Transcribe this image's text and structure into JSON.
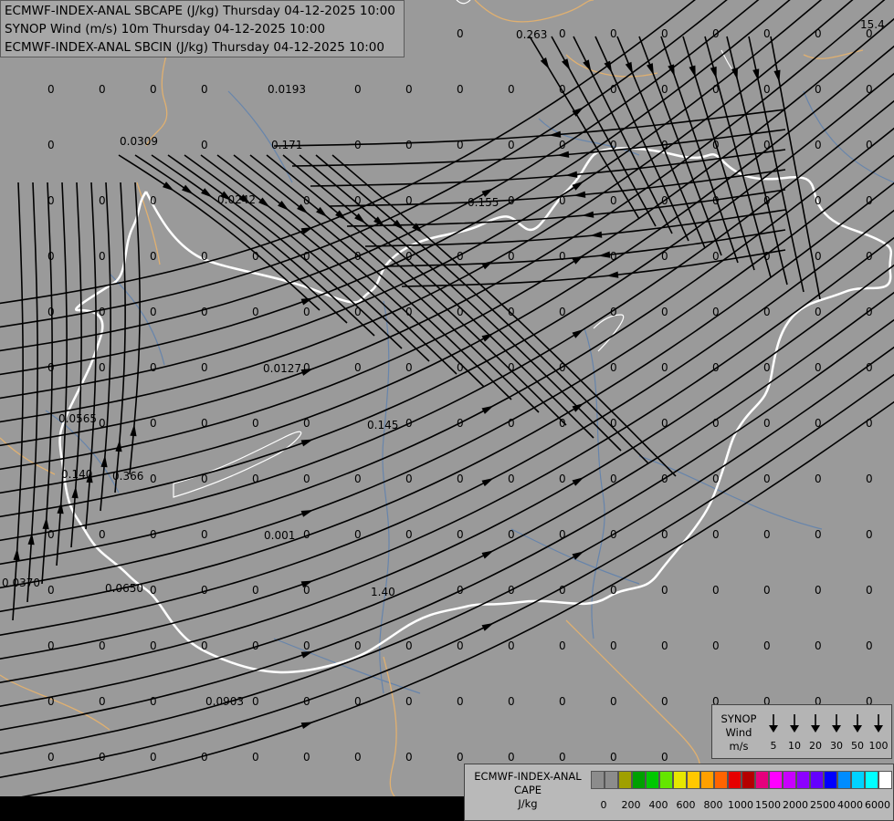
{
  "titles": [
    "ECMWF-INDEX-ANAL SBCAPE (J/kg) Thursday 04-12-2025 10:00",
    "SYNOP Wind (m/s) 10m Thursday 04-12-2025 10:00",
    "ECMWF-INDEX-ANAL SBCIN (J/kg) Thursday 04-12-2025 10:00"
  ],
  "corner_value": "15.4",
  "map_values": [
    "0",
    "0.263",
    "0.0193",
    "0.0309",
    "0.171",
    "0.0242",
    "0.155",
    "0.0127",
    "0.0565",
    "0.145",
    "0.140",
    "0.366",
    "0.001",
    "0.0370",
    "0.0650",
    "1.40",
    "0.0903",
    "0"
  ],
  "wind_legend": {
    "title": [
      "SYNOP",
      "Wind",
      "m/s"
    ],
    "values": [
      "5",
      "10",
      "20",
      "30",
      "50",
      "100"
    ]
  },
  "cape_legend": {
    "title": [
      "ECMWF-INDEX-ANAL",
      "CAPE",
      "J/kg"
    ],
    "colors": [
      "#8c8c8c",
      "#8c8c8c",
      "#a0a000",
      "#00a000",
      "#00c800",
      "#64e600",
      "#e6e600",
      "#ffc800",
      "#ffa000",
      "#ff6400",
      "#e60000",
      "#b40000",
      "#e6007d",
      "#ff00ff",
      "#c800ff",
      "#8c00ff",
      "#6400ff",
      "#0000ff",
      "#008cff",
      "#00d2ff",
      "#00ffff",
      "#ffffff"
    ],
    "ticks": [
      "0",
      "200",
      "400",
      "600",
      "800",
      "1000",
      "1500",
      "2000",
      "2500",
      "4000",
      "6000"
    ]
  },
  "colors": {
    "background": "#9a9a9a",
    "border": "#ffffff",
    "rivers": "#5a7fb0",
    "streamlines": "#000000"
  }
}
